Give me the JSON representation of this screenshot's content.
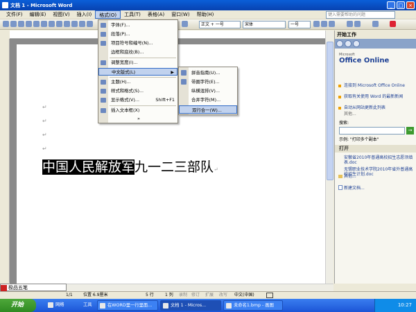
{
  "window": {
    "title": "文档 1 - Microsoft Word",
    "btn_min": "_",
    "btn_max": "□",
    "btn_close": "×"
  },
  "menubar": {
    "items": [
      "文件(F)",
      "编辑(E)",
      "视图(V)",
      "插入(I)",
      "格式(O)",
      "工具(T)",
      "表格(A)",
      "窗口(W)",
      "帮助(H)"
    ],
    "help_placeholder": "键入需要帮助的问题"
  },
  "toolbar": {
    "style": "正文 + 一号",
    "font": "宋体",
    "size": "一号"
  },
  "format_menu": {
    "items": [
      {
        "label": "字体(F)...",
        "shortcut": ""
      },
      {
        "label": "段落(P)...",
        "shortcut": ""
      },
      {
        "label": "项目符号和编号(N)...",
        "shortcut": ""
      },
      {
        "label": "边框和底纹(B)...",
        "shortcut": ""
      },
      {
        "label": "调整宽度(I)...",
        "shortcut": ""
      },
      {
        "label": "中文版式(L)",
        "shortcut": ""
      },
      {
        "label": "主题(H)...",
        "shortcut": ""
      },
      {
        "label": "样式和格式(S)...",
        "shortcut": ""
      },
      {
        "label": "显示格式(V)...",
        "shortcut": "Shift+F1"
      },
      {
        "label": "插入文本框(X)",
        "shortcut": ""
      }
    ],
    "expand": "»"
  },
  "chinese_submenu": {
    "items": [
      "拼音指南(U)...",
      "带圈字符(E)...",
      "纵横混排(V)...",
      "合并字符(M)...",
      "双行合一(W)..."
    ]
  },
  "document": {
    "selected_text": "中国人民解放军",
    "rest_text": "九一二三部队",
    "para_mark": "↵"
  },
  "taskpane": {
    "header": "开始工作",
    "logo_small": "Microsoft",
    "logo": "Office Online",
    "links": [
      "连接到 Microsoft Office Online",
      "获取有关使用 Word 的最新新闻",
      "自动从网站更新此列表"
    ],
    "more": "其他...",
    "search_label": "搜索:",
    "example": "示例: \"打印多个副本\"",
    "open_section": "打开",
    "files": [
      "安徽省2010年普通高校招生志愿须填表.doc",
      "无锡职业技术学院2010年省外普通高校招生计划.doc"
    ],
    "more2": "其他...",
    "new_doc": "新建文档..."
  },
  "status": {
    "page": "1/1",
    "position": "位置 6.9厘米",
    "line": "5 行",
    "col": "1 列",
    "rec": "录制",
    "trk": "修订",
    "ext": "扩展",
    "ovr": "改写",
    "lang": "中文(中国)"
  },
  "ime": {
    "name": "极品五笔"
  },
  "taskbar": {
    "start": "开始",
    "items": [
      "网络",
      "工具",
      "在WORD里一行里面...",
      "文档 1 - Micros...",
      "未命名1.bmp - 画图"
    ],
    "clock": "10:27"
  }
}
